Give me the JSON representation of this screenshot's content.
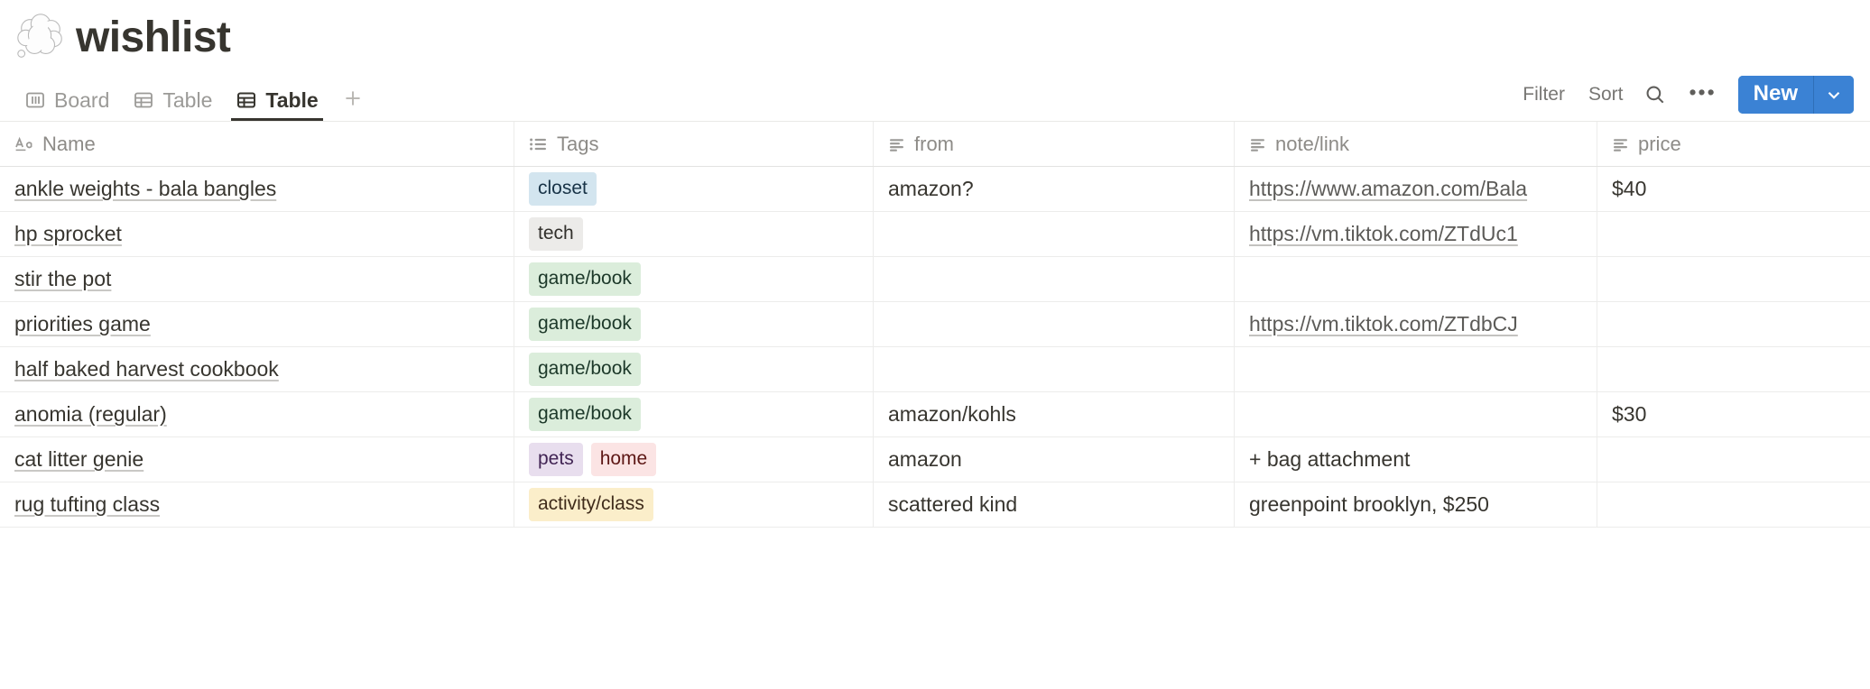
{
  "page": {
    "emoji_name": "thought-balloon-emoji",
    "title": "wishlist"
  },
  "views": [
    {
      "label": "Board",
      "icon": "board-view-icon",
      "active": false
    },
    {
      "label": "Table",
      "icon": "table-view-icon",
      "active": false
    },
    {
      "label": "Table",
      "icon": "table-view-icon",
      "active": true
    }
  ],
  "view_add_label": "+",
  "toolbar": {
    "filter_label": "Filter",
    "sort_label": "Sort",
    "search_icon": "search-icon",
    "more_label": "•••",
    "new_label": "New",
    "new_caret_icon": "chevron-down-icon",
    "accent_color": "#3b82d4"
  },
  "table": {
    "columns": [
      {
        "key": "name",
        "label": "Name",
        "icon": "title-type-icon"
      },
      {
        "key": "tags",
        "label": "Tags",
        "icon": "multi-select-type-icon"
      },
      {
        "key": "from",
        "label": "from",
        "icon": "text-type-icon"
      },
      {
        "key": "note",
        "label": "note/link",
        "icon": "text-type-icon"
      },
      {
        "key": "price",
        "label": "price",
        "icon": "text-type-icon"
      }
    ],
    "tag_colors": {
      "closet": {
        "bg": "#d3e5ef",
        "fg": "#183347"
      },
      "tech": {
        "bg": "#ecebe9",
        "fg": "#32302c"
      },
      "game/book": {
        "bg": "#dbeddb",
        "fg": "#1c3829"
      },
      "pets": {
        "bg": "#e8deee",
        "fg": "#412454"
      },
      "home": {
        "bg": "#fbe4e4",
        "fg": "#5d1715"
      },
      "activity/class": {
        "bg": "#fbeeca",
        "fg": "#402c1b"
      }
    },
    "rows": [
      {
        "name": "ankle weights - bala bangles",
        "tags": [
          "closet"
        ],
        "from": "amazon?",
        "note": "https://www.amazon.com/Bala",
        "note_is_link": true,
        "price": "$40"
      },
      {
        "name": "hp sprocket",
        "tags": [
          "tech"
        ],
        "from": "",
        "note": "https://vm.tiktok.com/ZTdUc1",
        "note_is_link": true,
        "price": ""
      },
      {
        "name": "stir the pot",
        "tags": [
          "game/book"
        ],
        "from": "",
        "note": "",
        "note_is_link": false,
        "price": ""
      },
      {
        "name": "priorities game",
        "tags": [
          "game/book"
        ],
        "from": "",
        "note": "https://vm.tiktok.com/ZTdbCJ",
        "note_is_link": true,
        "price": ""
      },
      {
        "name": "half baked harvest cookbook",
        "tags": [
          "game/book"
        ],
        "from": "",
        "note": "",
        "note_is_link": false,
        "price": ""
      },
      {
        "name": "anomia (regular)",
        "tags": [
          "game/book"
        ],
        "from": "amazon/kohls",
        "note": "",
        "note_is_link": false,
        "price": "$30"
      },
      {
        "name": "cat litter genie",
        "tags": [
          "pets",
          "home"
        ],
        "from": "amazon",
        "note": "+ bag attachment",
        "note_is_link": false,
        "price": ""
      },
      {
        "name": "rug tufting class",
        "tags": [
          "activity/class"
        ],
        "from": "scattered kind",
        "note": "greenpoint brooklyn, $250",
        "note_is_link": false,
        "price": ""
      }
    ]
  }
}
